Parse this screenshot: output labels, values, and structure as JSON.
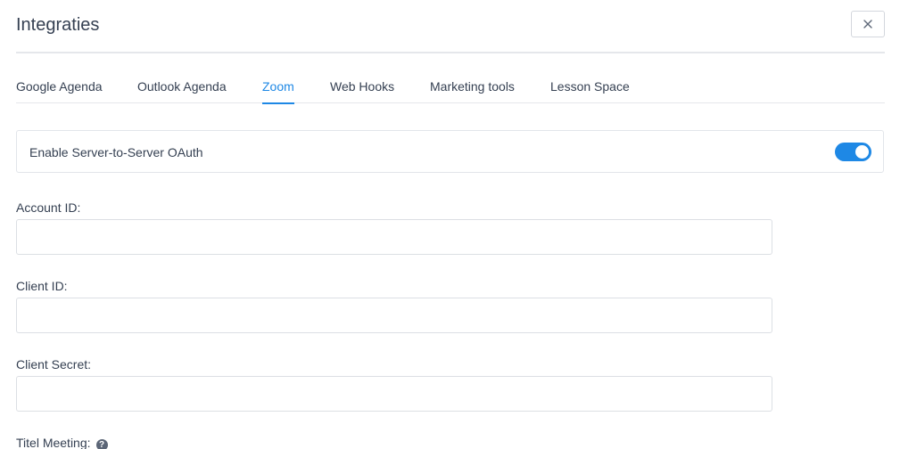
{
  "header": {
    "title": "Integraties"
  },
  "tabs": [
    {
      "label": "Google Agenda"
    },
    {
      "label": "Outlook Agenda"
    },
    {
      "label": "Zoom"
    },
    {
      "label": "Web Hooks"
    },
    {
      "label": "Marketing tools"
    },
    {
      "label": "Lesson Space"
    }
  ],
  "active_tab": "Zoom",
  "oauth": {
    "label": "Enable Server-to-Server OAuth",
    "enabled": true
  },
  "fields": [
    {
      "label": "Account ID:",
      "value": ""
    },
    {
      "label": "Client ID:",
      "value": ""
    },
    {
      "label": "Client Secret:",
      "value": ""
    },
    {
      "label": "Titel Meeting:"
    }
  ],
  "colors": {
    "accent": "#1e88e5",
    "text": "#354052",
    "border": "#e2e5ea"
  },
  "icons": {
    "close": "close-icon",
    "help": "question-circle-icon"
  }
}
